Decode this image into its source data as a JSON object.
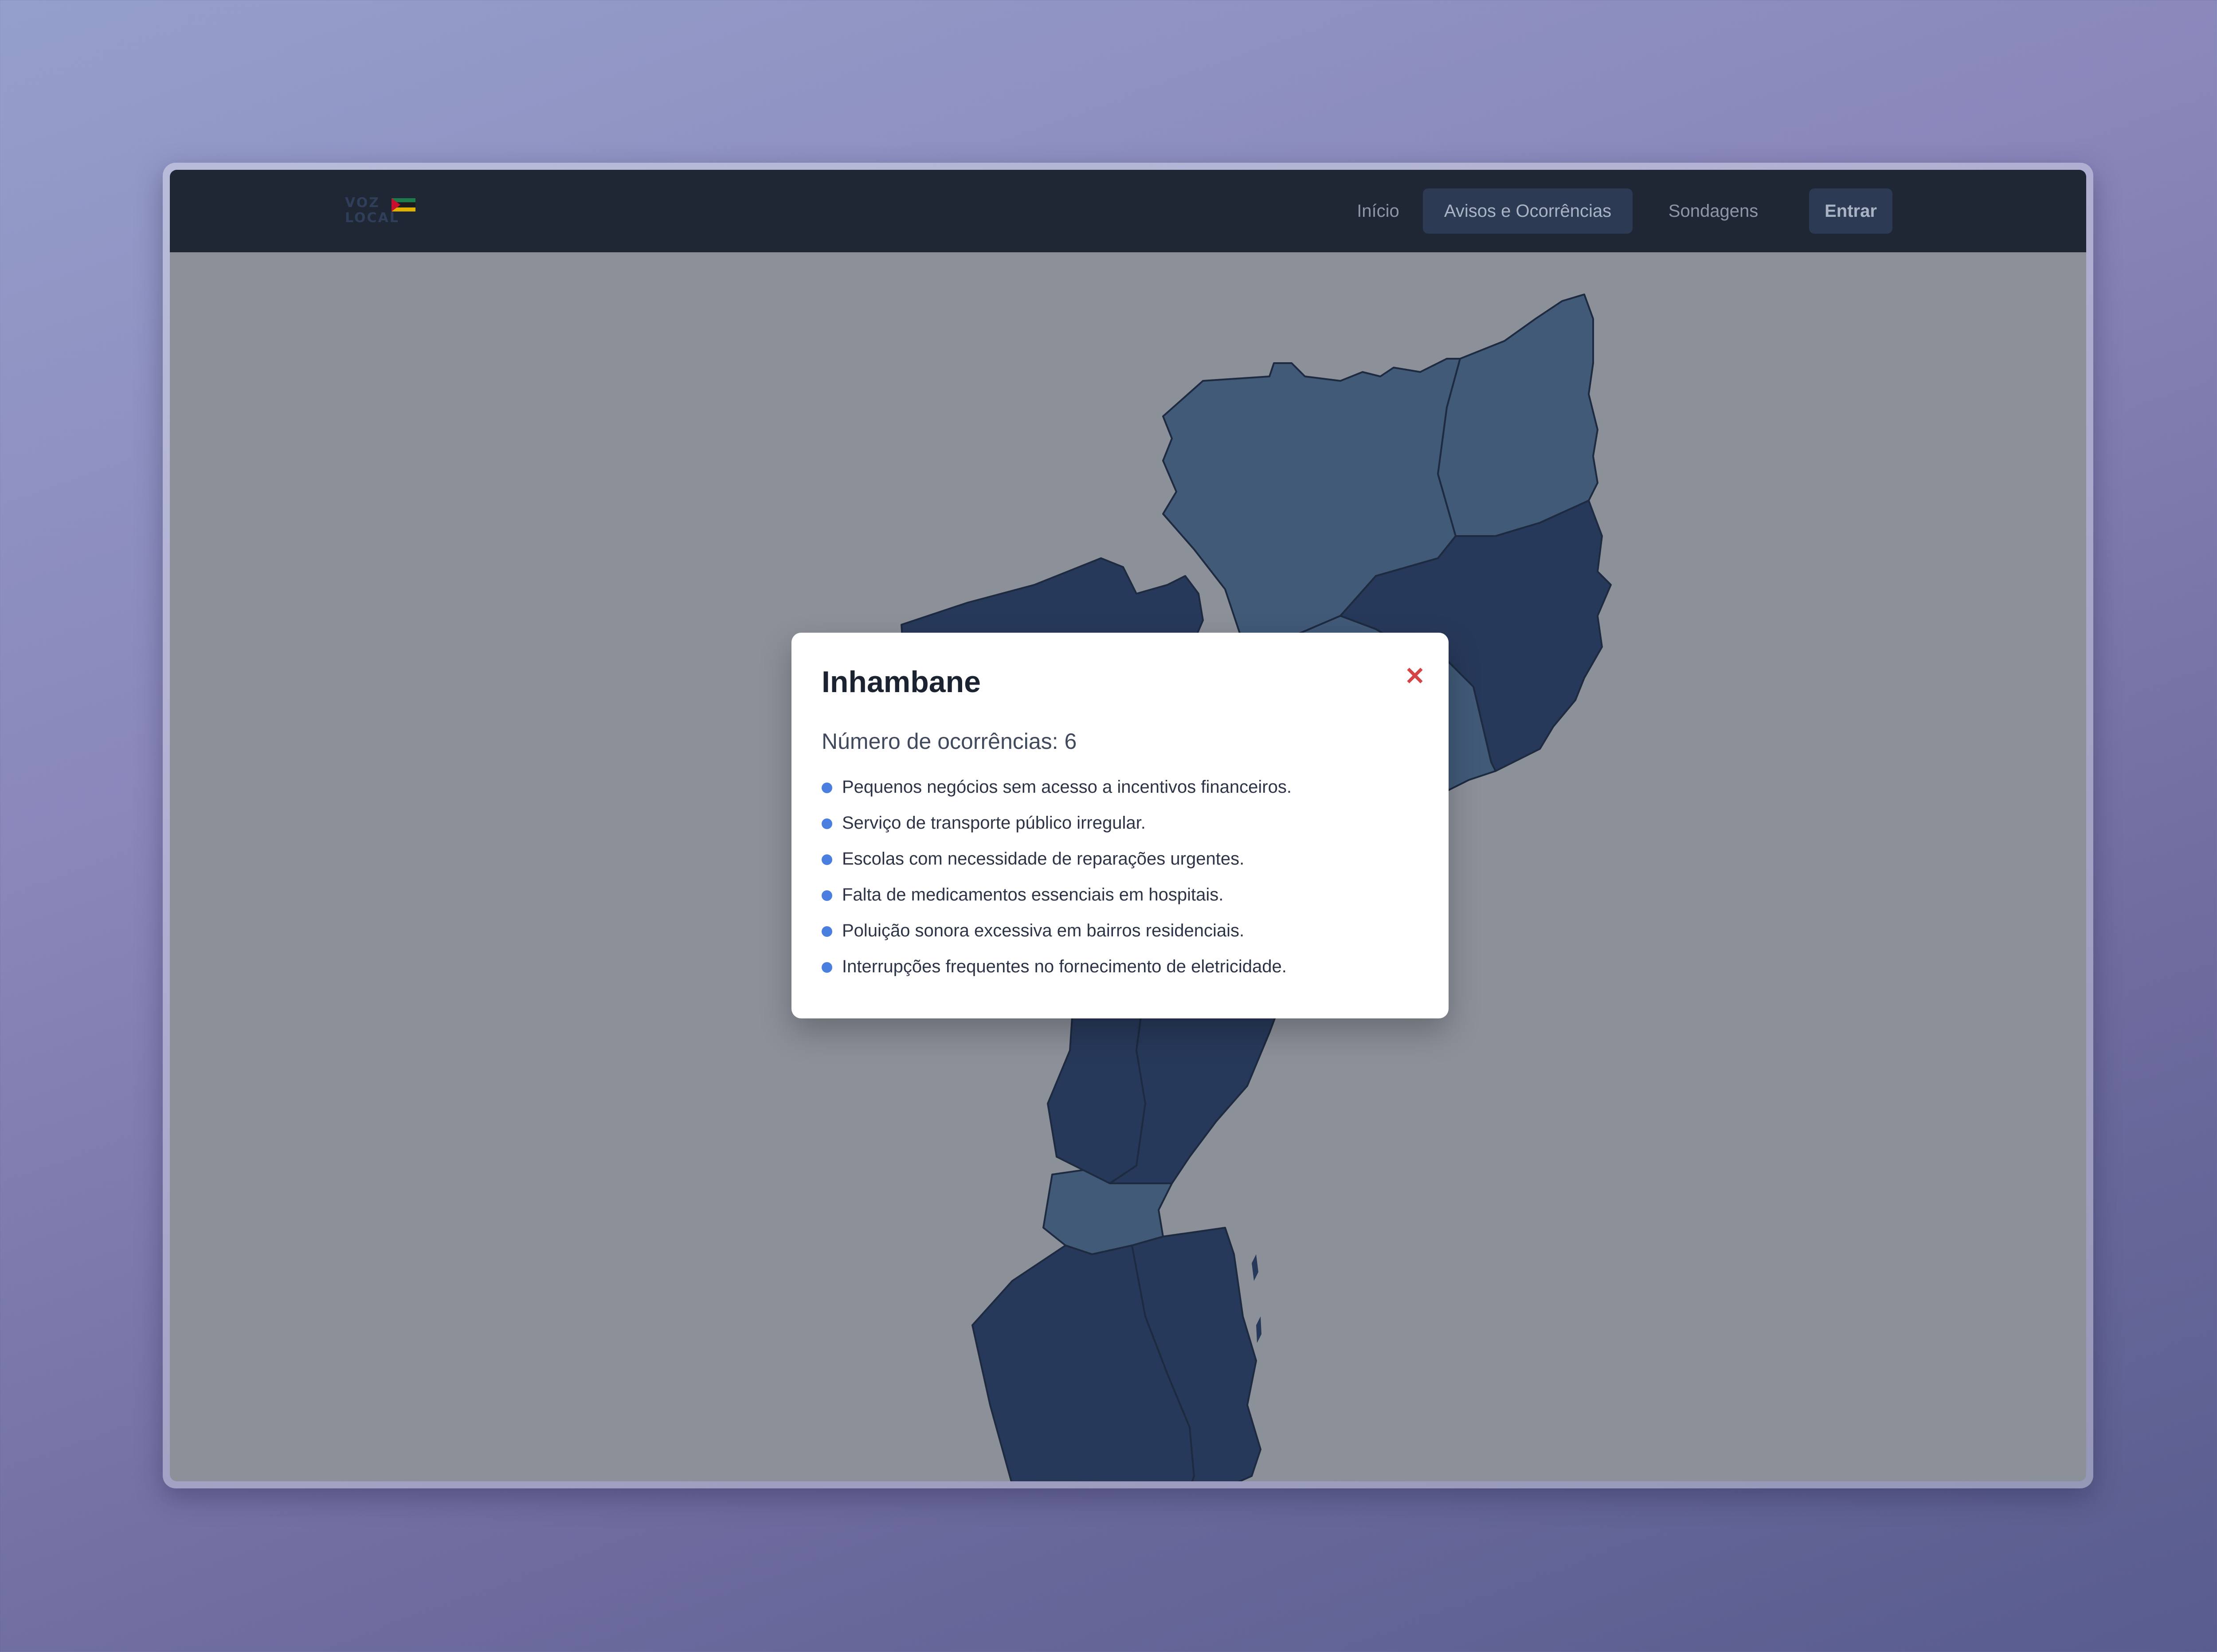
{
  "logo": {
    "line1": "VOZ",
    "line2": "LOCAL",
    "flag_colors": [
      "#1d7a4a",
      "#1b1b1b",
      "#e0b000",
      "#c8102e"
    ]
  },
  "nav": {
    "items": [
      {
        "label": "Início"
      },
      {
        "label": "Avisos e Ocorrências",
        "active": true
      },
      {
        "label": "Sondagens"
      }
    ],
    "login_label": "Entrar"
  },
  "map": {
    "colors": {
      "dark": "#27395a",
      "medium": "#415a78",
      "light": "#c7c9cf",
      "background": "#8c9099"
    }
  },
  "modal": {
    "title": "Inhambane",
    "close_symbol": "✕",
    "count_label": "Número de ocorrências: 6",
    "items": [
      "Pequenos negócios sem acesso a incentivos financeiros.",
      "Serviço de transporte público irregular.",
      "Escolas com necessidade de reparações urgentes.",
      "Falta de medicamentos essenciais em hospitais.",
      "Poluição sonora excessiva em bairros residenciais.",
      "Interrupções frequentes no fornecimento de eletricidade."
    ]
  }
}
